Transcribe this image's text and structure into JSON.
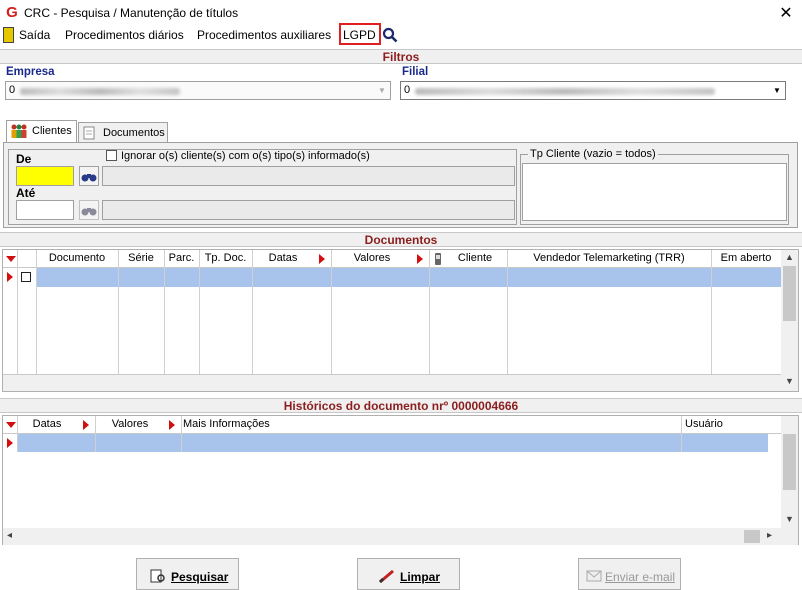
{
  "window": {
    "title": "CRC - Pesquisa / Manutenção de títulos",
    "close": "✕"
  },
  "menu": {
    "exit": "Saída",
    "daily": "Procedimentos diários",
    "aux": "Procedimentos auxiliares",
    "lgpd": "LGPD"
  },
  "filters": {
    "heading": "Filtros",
    "empresa_label": "Empresa",
    "empresa_value": "0",
    "filial_label": "Filial",
    "filial_value": "0",
    "tabs": [
      "Clientes",
      "Documentos"
    ],
    "de_label": "De",
    "ate_label": "Até",
    "ignore_label": "Ignorar o(s) cliente(s) com o(s) tipo(s) informado(s)",
    "tp_cliente_label": "Tp Cliente (vazio = todos)"
  },
  "documents": {
    "heading": "Documentos",
    "columns": [
      "Documento",
      "Série",
      "Parc.",
      "Tp. Doc.",
      "Datas",
      "Valores",
      "Cliente",
      "Vendedor Telemarketing (TRR)",
      "Em aberto"
    ]
  },
  "history": {
    "heading": "Históricos do documento nrº 0000004666",
    "columns": [
      "Datas",
      "Valores",
      "Mais Informações",
      "Usuário"
    ]
  },
  "buttons": {
    "search": "Pesquisar",
    "clear": "Limpar",
    "email": "Enviar e-mail"
  },
  "colors": {
    "accent_red": "#d01010",
    "heading_red": "#8b1e1e",
    "label_blue": "#1a2a8a",
    "selected_row": "#a8c4ec",
    "de_field": "#ffff00"
  }
}
